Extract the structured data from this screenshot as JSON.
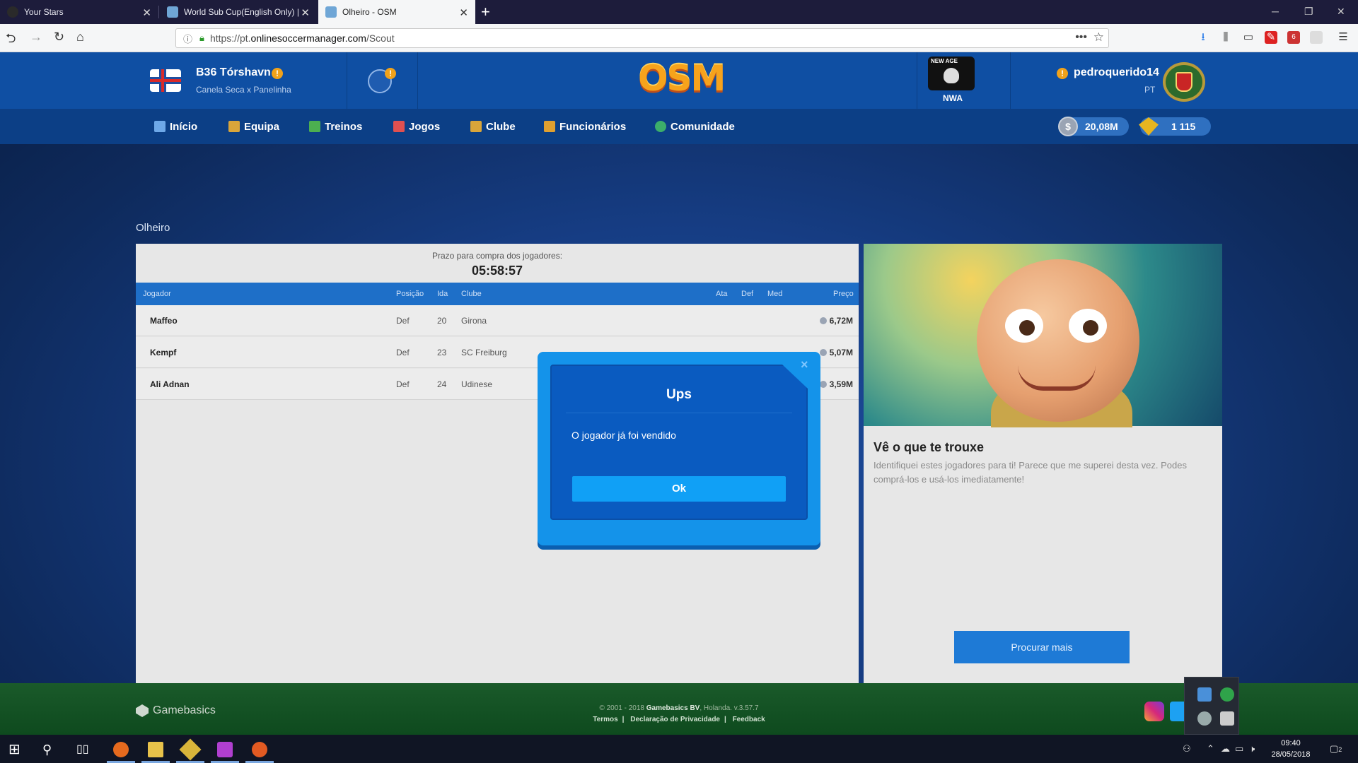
{
  "browser": {
    "tabs": [
      {
        "title": "Your Stars",
        "active": false
      },
      {
        "title": "World Sub Cup(English Only) |",
        "active": false
      },
      {
        "title": "Olheiro - OSM",
        "active": true
      }
    ],
    "url_prefix": "https://pt.",
    "url_domain": "onlinesoccermanager.com",
    "url_path": "/Scout",
    "badge_count": "6"
  },
  "header": {
    "club_name": "B36 Tórshavn",
    "club_match": "Canela Seca x Panelinha",
    "logo": "OSM",
    "league_badge": "NWA",
    "league_badge_text": "NEW AGE",
    "username": "pedroquerido14",
    "country": "PT"
  },
  "nav": {
    "items": [
      "Início",
      "Equipa",
      "Treinos",
      "Jogos",
      "Clube",
      "Funcionários",
      "Comunidade"
    ],
    "money": "20,08M",
    "coins": "1 115"
  },
  "scout": {
    "section_title": "Olheiro",
    "deadline_label": "Prazo para compra dos jogadores:",
    "deadline_time": "05:58:57",
    "columns": {
      "player": "Jogador",
      "position": "Posição",
      "age": "Ida",
      "club": "Clube",
      "att": "Ata",
      "def": "Def",
      "mid": "Med",
      "price": "Preço"
    },
    "rows": [
      {
        "name": "Maffeo",
        "position": "Def",
        "age": "20",
        "club": "Girona",
        "price": "6,72M"
      },
      {
        "name": "Kempf",
        "position": "Def",
        "age": "23",
        "club": "SC Freiburg",
        "price": "5,07M"
      },
      {
        "name": "Ali Adnan",
        "position": "Def",
        "age": "24",
        "club": "Udinese",
        "price": "3,59M"
      }
    ]
  },
  "promo": {
    "title": "Vê o que te trouxe",
    "text": "Identifiquei estes jogadores para ti! Parece que me superei desta vez. Podes comprá-los e usá-los imediatamente!",
    "button": "Procurar mais"
  },
  "footer": {
    "brand": "Gamebasics",
    "copyright_prefix": "© 2001 - 2018",
    "copyright_company": "Gamebasics BV",
    "copyright_suffix": ", Holanda. v.3.57.7",
    "links": [
      "Termos",
      "Declaração de Privacidade",
      "Feedback"
    ]
  },
  "modal": {
    "close": "×",
    "title": "Ups",
    "message": "O jogador já foi vendido",
    "ok": "Ok"
  },
  "taskbar": {
    "time": "09:40",
    "date": "28/05/2018",
    "notif_count": "2"
  },
  "colors": {
    "brand_blue": "#0f4fa3",
    "modal_blue": "#1493ea",
    "button_blue": "#1e7ad6",
    "footer_green": "#1a5a2a"
  }
}
